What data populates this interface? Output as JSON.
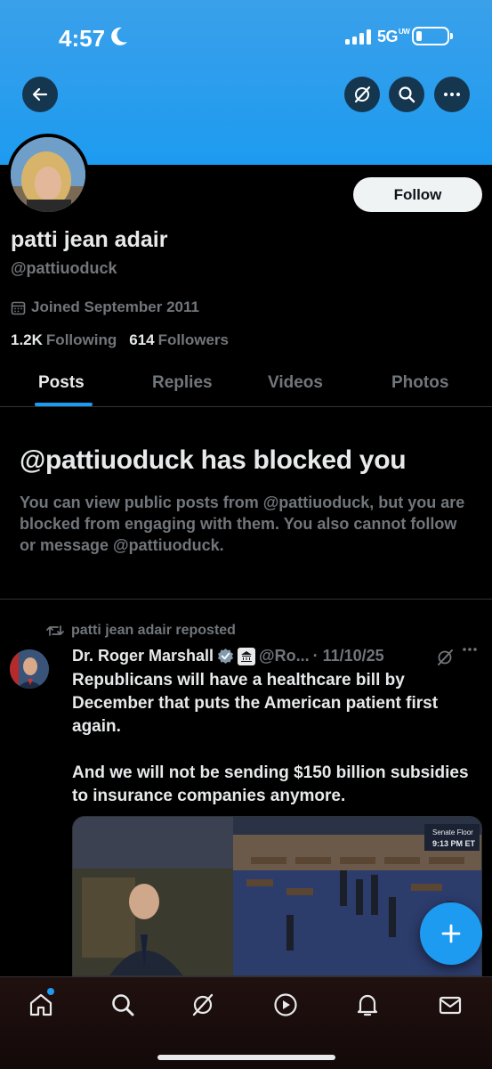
{
  "status_bar": {
    "time": "4:57",
    "network": "5G",
    "network_suffix": "UW"
  },
  "profile": {
    "display_name": "patti jean adair",
    "handle": "@pattiuoduck",
    "joined": "Joined September 2011",
    "following_count": "1.2K",
    "following_label": "Following",
    "followers_count": "614",
    "followers_label": "Followers",
    "follow_label": "Follow"
  },
  "tabs": [
    {
      "label": "Posts",
      "active": true
    },
    {
      "label": "Replies",
      "active": false
    },
    {
      "label": "Videos",
      "active": false
    },
    {
      "label": "Photos",
      "active": false
    }
  ],
  "blocked": {
    "title": "@pattiuoduck has blocked you",
    "description": "You can view public posts from @pattiuoduck, but you are blocked from engaging with them. You also cannot follow or message @pattiuoduck."
  },
  "post": {
    "repost_label": "patti jean adair reposted",
    "author": "Dr. Roger Marshall",
    "author_handle": "@Ro...",
    "date": "· 11/10/25",
    "text": "Republicans will have a healthcare bill by December that puts the American patient first again.\n\nAnd we will not be sending $150 billion subsidies to insurance companies anymore.",
    "media": {
      "chyron_line1": "Senate Floor",
      "chyron_line2": "9:13 PM ET"
    }
  },
  "colors": {
    "accent": "#1d9bf0",
    "background": "#000000",
    "muted": "#71767b"
  },
  "icons": [
    "back-arrow-icon",
    "grok-icon",
    "search-icon",
    "more-icon",
    "calendar-icon",
    "repost-icon",
    "verified-badge-icon",
    "government-badge-icon",
    "plus-icon",
    "home-icon",
    "notifications-icon",
    "messages-icon",
    "play-icon"
  ]
}
